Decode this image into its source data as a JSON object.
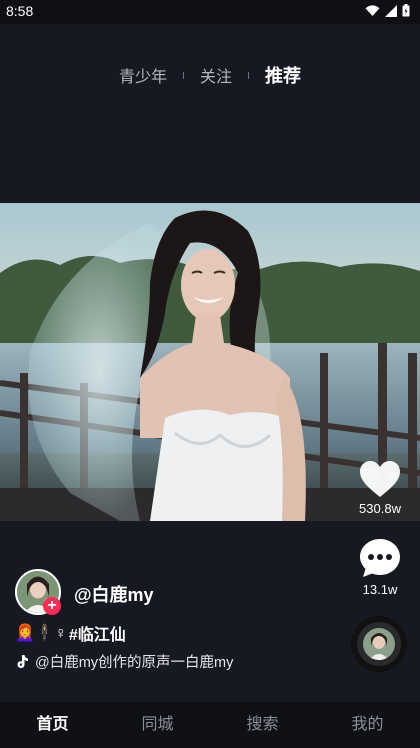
{
  "status_bar": {
    "time": "8:58"
  },
  "top_tabs": [
    {
      "label": "青少年"
    },
    {
      "label": "关注"
    },
    {
      "label": "推荐",
      "active": true
    }
  ],
  "rail": {
    "likes": "530.8w",
    "comments": "13.1w"
  },
  "author": {
    "name": "@白鹿my"
  },
  "caption": {
    "emoji_text": "👩‍🦰🕴♀",
    "hashtag": "#临江仙"
  },
  "music": {
    "text": "@白鹿my创作的原声一白鹿my"
  },
  "bottom_nav": [
    {
      "label": "首页",
      "active": true
    },
    {
      "label": "同城"
    },
    {
      "label": "搜索"
    },
    {
      "label": "我的"
    }
  ],
  "colors": {
    "background": "#171922",
    "accent": "#fe2c55",
    "nav_bg": "#101117"
  }
}
